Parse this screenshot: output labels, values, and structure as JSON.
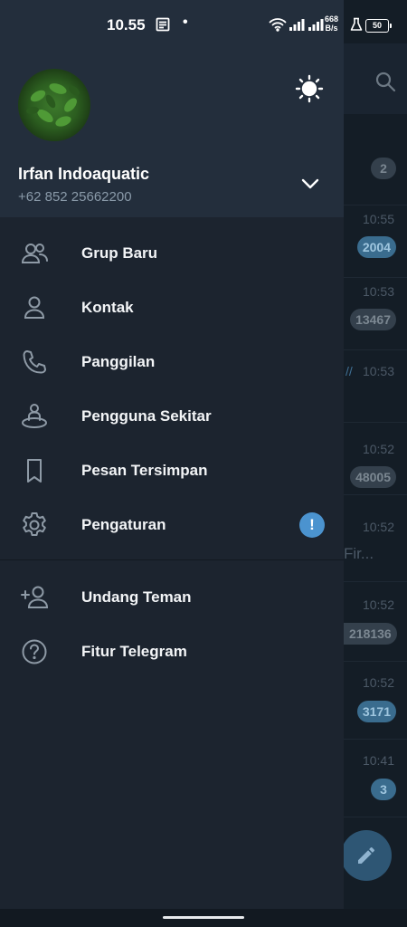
{
  "status_bar": {
    "time": "10.55",
    "dot": "•",
    "net_speed_value": "668",
    "net_speed_unit": "B/s",
    "battery": "50"
  },
  "drawer": {
    "profile": {
      "name": "Irfan Indoaquatic",
      "phone": "+62 852 25662200"
    },
    "menu": [
      {
        "label": "Grup Baru",
        "icon": "group-icon"
      },
      {
        "label": "Kontak",
        "icon": "person-icon"
      },
      {
        "label": "Panggilan",
        "icon": "phone-icon"
      },
      {
        "label": "Pengguna Sekitar",
        "icon": "nearby-people-icon"
      },
      {
        "label": "Pesan Tersimpan",
        "icon": "bookmark-icon"
      },
      {
        "label": "Pengaturan",
        "icon": "gear-icon",
        "badge": "!"
      }
    ],
    "secondary_menu": [
      {
        "label": "Undang Teman",
        "icon": "add-person-icon"
      },
      {
        "label": "Fitur Telegram",
        "icon": "help-circle-icon"
      }
    ]
  },
  "background_chats": [
    {
      "time": "",
      "badge": "2",
      "badge_style": "muted"
    },
    {
      "time": "10:55",
      "badge": "2004",
      "badge_style": "blue"
    },
    {
      "time": "10:53",
      "badge": "13467",
      "badge_style": "muted"
    },
    {
      "time": "10:53",
      "badge": "",
      "badge_style": "none",
      "check": "//"
    },
    {
      "time": "10:52",
      "badge": "48005",
      "badge_style": "muted"
    },
    {
      "time": "10:52",
      "badge": "",
      "badge_style": "none",
      "preview": "Fir..."
    },
    {
      "time": "10:52",
      "badge": "218136",
      "badge_style": "muted"
    },
    {
      "time": "10:52",
      "badge": "3171",
      "badge_style": "blue"
    },
    {
      "time": "10:41",
      "badge": "3",
      "badge_style": "blue"
    }
  ],
  "colors": {
    "drawer_bg": "#1c242f",
    "header_bg": "#232e3c",
    "accent": "#4b93cf",
    "phone_text": "#8a9aa9",
    "icon_stroke": "#8e9aa6"
  }
}
